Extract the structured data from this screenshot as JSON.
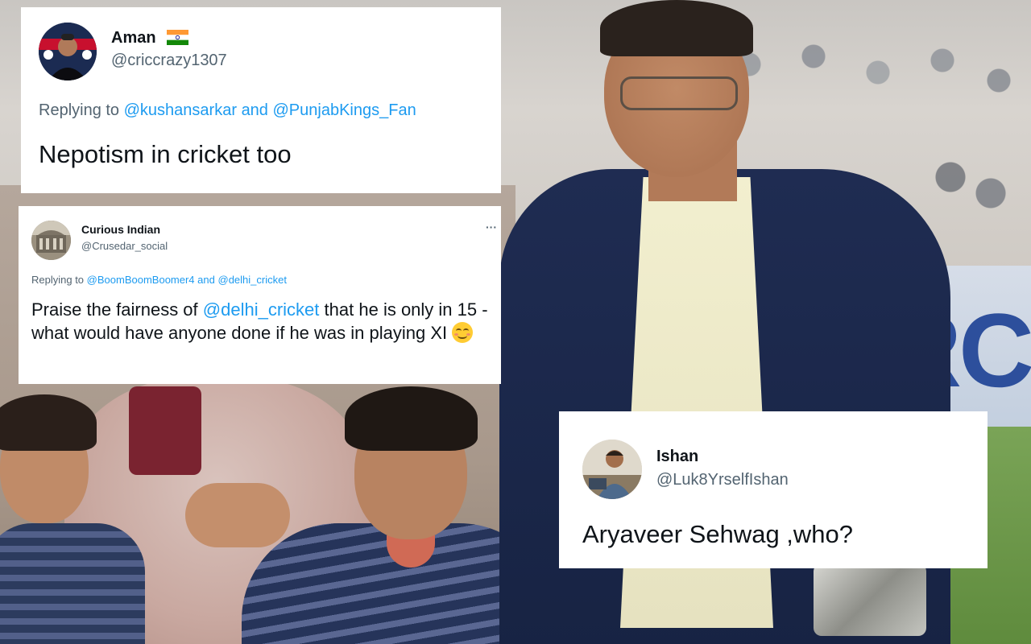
{
  "background": {
    "hoarding_text": "URC"
  },
  "tweets": [
    {
      "name": "Aman",
      "handle": "@criccrazy1307",
      "reply_prefix": "Replying to",
      "reply_mention_1": "@kushansarkar",
      "reply_and": "and",
      "reply_mention_2": "@PunjabKings_Fan",
      "text": "Nepotism in cricket too",
      "flag_icon": "india-flag-icon"
    },
    {
      "name": "Curious Indian",
      "handle": "@Crusedar_social",
      "more": "···",
      "reply_prefix": "Replying to",
      "reply_mention_1": "@BoomBoomBoomer4",
      "reply_and": "and",
      "reply_mention_2": "@delhi_cricket",
      "text_before": "Praise the fairness of",
      "text_mention": "@delhi_cricket",
      "text_after": "that he is only in 15 - what would have anyone done if he was in playing XI",
      "emoji_icon": "smiling-face-icon"
    },
    {
      "name": "Ishan",
      "handle": "@Luk8YrselfIshan",
      "text": "Aryaveer Sehwag ,who?"
    }
  ],
  "colors": {
    "link_blue": "#1d9bf0",
    "muted_gray": "#536471",
    "text_dark": "#0f1419"
  }
}
